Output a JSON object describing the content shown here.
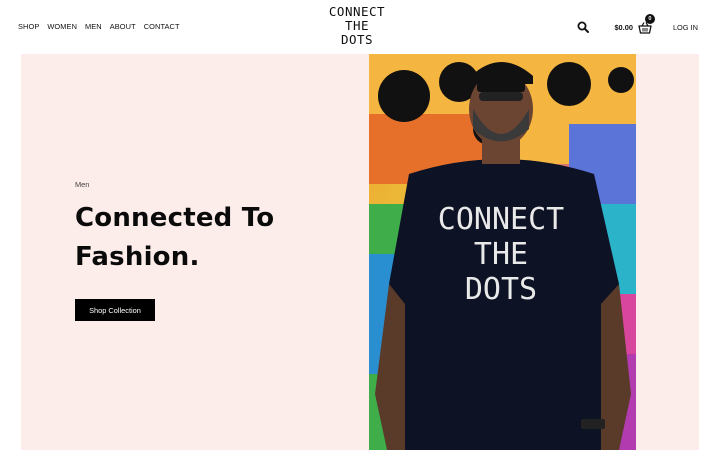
{
  "header": {
    "nav": [
      "SHOP",
      "WOMEN",
      "MEN",
      "ABOUT",
      "CONTACT"
    ],
    "logo_lines": [
      "CONNECT",
      "THE",
      "DOTS"
    ],
    "cart_amount": "$0.00",
    "cart_count": "0",
    "login_label": "LOG IN",
    "icons": {
      "search": "search-icon",
      "cart": "basket-icon"
    }
  },
  "hero": {
    "eyebrow": "Men",
    "headline_line1": "Connected To",
    "headline_line2": "Fashion.",
    "cta_label": "Shop Collection",
    "shirt_lines": [
      "CONNECT",
      "THE",
      "DOTS"
    ],
    "background_color": "#fcecea"
  }
}
